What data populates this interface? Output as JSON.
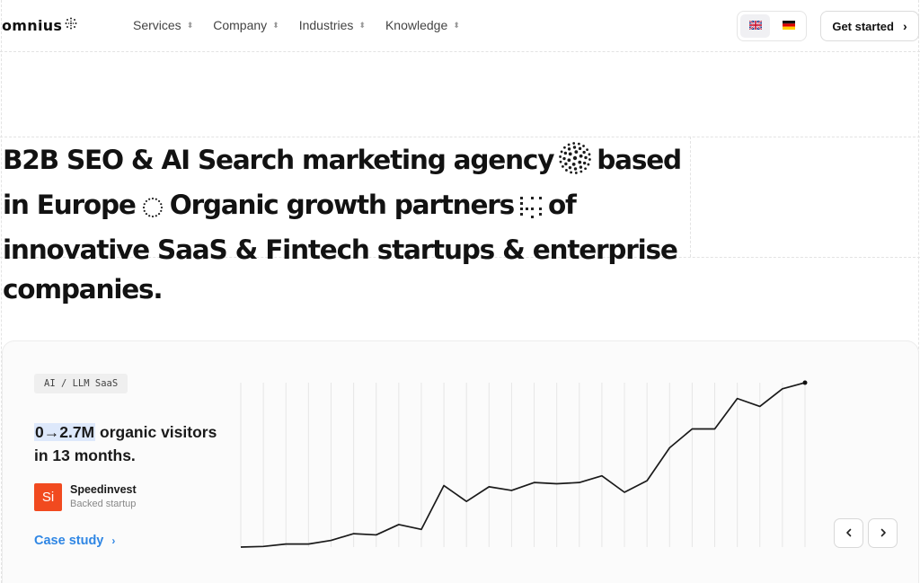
{
  "header": {
    "logo_text": "omnius",
    "nav": [
      {
        "label": "Services"
      },
      {
        "label": "Company"
      },
      {
        "label": "Industries"
      },
      {
        "label": "Knowledge"
      }
    ],
    "languages": [
      {
        "code": "EN",
        "icon": "uk-flag-icon",
        "active": true
      },
      {
        "code": "DE",
        "icon": "germany-flag-icon",
        "active": false
      }
    ],
    "cta_label": "Get started"
  },
  "hero": {
    "part1": "B2B SEO & AI Search marketing agency",
    "part2": "based in Europe",
    "part3": "Organic growth partners",
    "part4": "of innovative SaaS & Fintech startups & enterprise companies."
  },
  "case": {
    "tag": "AI / LLM SaaS",
    "stat_highlight": "0→2.7M",
    "stat_rest": " organic visitors in 13 months.",
    "brand_logo_text": "Si",
    "brand_name": "Speedinvest",
    "brand_subtitle": "Backed startup",
    "link_label": "Case study",
    "accent_color": "#2f86e4"
  },
  "chart_data": {
    "type": "line",
    "title": "",
    "xlabel": "",
    "ylabel": "",
    "x": [
      1,
      2,
      3,
      4,
      5,
      6,
      7,
      8,
      9,
      10,
      11,
      12,
      13,
      14,
      15,
      16,
      17,
      18,
      19,
      20,
      21,
      22,
      23,
      24,
      25
    ],
    "series": [
      {
        "values": [
          0.0,
          0.01,
          0.05,
          0.05,
          0.11,
          0.22,
          0.2,
          0.37,
          0.29,
          1.01,
          0.75,
          0.99,
          0.93,
          1.06,
          1.04,
          1.06,
          1.17,
          0.9,
          1.09,
          1.63,
          1.94,
          1.94,
          2.44,
          2.31,
          2.6,
          2.7
        ]
      }
    ],
    "ylim": [
      0,
      2.7
    ],
    "grid": "vertical"
  }
}
